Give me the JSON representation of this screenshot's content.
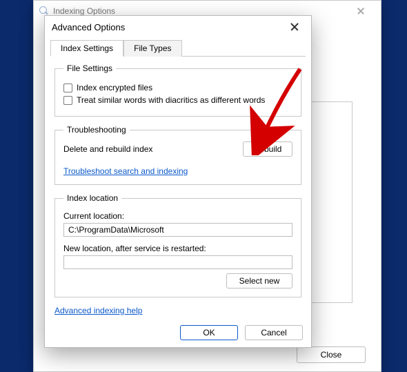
{
  "outerWindow": {
    "title": "Indexing Options",
    "closeLabel": "Close"
  },
  "dialog": {
    "title": "Advanced Options",
    "tabs": {
      "settings": "Index Settings",
      "filetypes": "File Types"
    },
    "fileSettings": {
      "legend": "File Settings",
      "encrypt": "Index encrypted files",
      "diacritics": "Treat similar words with diacritics as different words"
    },
    "troubleshooting": {
      "legend": "Troubleshooting",
      "desc": "Delete and rebuild index",
      "rebuild": "Rebuild",
      "link": "Troubleshoot search and indexing"
    },
    "location": {
      "legend": "Index location",
      "currentLabel": "Current location:",
      "currentValue": "C:\\ProgramData\\Microsoft",
      "newLabel": "New location, after service is restarted:",
      "newValue": "",
      "selectNew": "Select new"
    },
    "helpLink": "Advanced indexing help",
    "ok": "OK",
    "cancel": "Cancel"
  }
}
